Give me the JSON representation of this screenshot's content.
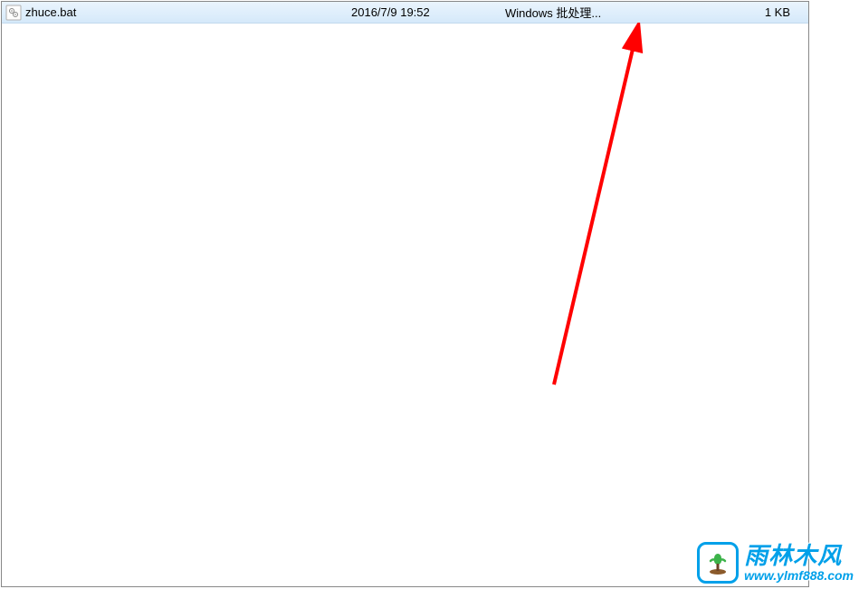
{
  "file_row": {
    "name": "zhuce.bat",
    "date_modified": "2016/7/9 19:52",
    "type": "Windows 批处理...",
    "size": "1 KB"
  },
  "watermark": {
    "brand_cn": "雨林木风",
    "url": "www.ylmf888.com"
  },
  "colors": {
    "row_selected_bg_top": "#eaf4fd",
    "row_selected_bg_bottom": "#d5e9fa",
    "arrow": "#ff0000",
    "brand": "#00a0e9"
  }
}
